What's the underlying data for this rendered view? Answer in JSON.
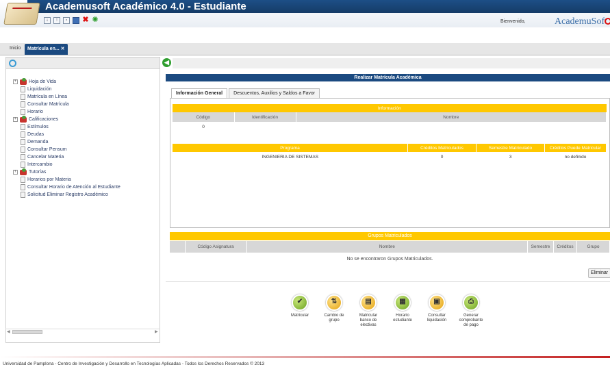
{
  "header": {
    "title": "Academusoft Académico 4.0 - Estudiante",
    "brand": "AcademuSoft",
    "welcome": "Bienvenido,"
  },
  "tabs": {
    "home": "Inicio",
    "active": "Matrícula en... ✕"
  },
  "sidebar": {
    "items": [
      {
        "label": "Hoja de Vida",
        "type": "folder"
      },
      {
        "label": "Liquidación",
        "type": "page"
      },
      {
        "label": "Matrícula en Línea",
        "type": "page"
      },
      {
        "label": "Consultar Matrícula",
        "type": "page"
      },
      {
        "label": "Horario",
        "type": "page"
      },
      {
        "label": "Calificaciones",
        "type": "folder"
      },
      {
        "label": "Estímulos",
        "type": "page"
      },
      {
        "label": "Deudas",
        "type": "page"
      },
      {
        "label": "Demanda",
        "type": "page"
      },
      {
        "label": "Consultar Pensum",
        "type": "page"
      },
      {
        "label": "Cancelar Materia",
        "type": "page"
      },
      {
        "label": "Intercambio",
        "type": "page"
      },
      {
        "label": "Tutorías",
        "type": "folder"
      },
      {
        "label": "Horarios por Materia",
        "type": "page"
      },
      {
        "label": "Consultar Horario de Atención al Estudiante",
        "type": "page"
      },
      {
        "label": "Solicitud Eliminar Registro Académico",
        "type": "page"
      }
    ]
  },
  "main": {
    "panel_title": "Realizar Matrícula Académica",
    "tab_general": "Información General",
    "tab_descuentos": "Descuentos, Auxilios y Saldos a Favor",
    "info_title": "Información",
    "info_headers": [
      "Código",
      "Identificación",
      "Nombre"
    ],
    "info_row": [
      "0",
      "",
      ""
    ],
    "program_headers": [
      "Programa",
      "Créditos Matriculados",
      "Semestre Matriculado",
      "Créditos Puede Matricular"
    ],
    "program_row": [
      "INGENIERIA DE SISTEMAS",
      "0",
      "3",
      "no definido"
    ],
    "groups_title": "Grupos Matriculados",
    "groups_headers": [
      "",
      "Código Asignatura",
      "Nombre",
      "Semestre",
      "Créditos",
      "Grupo"
    ],
    "no_groups": "No se encontraron Grupos Matriculados.",
    "delete_button": "Eliminar"
  },
  "actions": [
    {
      "label": "Matricular",
      "icon": "check-icon",
      "color": "green"
    },
    {
      "label": "Cambio de grupo",
      "icon": "swap-icon",
      "color": "orange"
    },
    {
      "label": "Matricular banco de electivas",
      "icon": "book-icon",
      "color": "orange"
    },
    {
      "label": "Horario estudiante",
      "icon": "calendar-icon",
      "color": "green"
    },
    {
      "label": "Consultar liquidación",
      "icon": "receipt-icon",
      "color": "orange"
    },
    {
      "label": "Generar comprobante de pago",
      "icon": "print-icon",
      "color": "green"
    }
  ],
  "footer": {
    "text": "Universidad de Pamplona - Centro de Investigación y Desarrollo en Tecnologías Aplicadas - Todos los Derechos Reservados © 2013"
  },
  "colors": {
    "header_blue": "#1b4a80",
    "accent_yellow": "#ffc800",
    "footer_red": "#c42020"
  }
}
